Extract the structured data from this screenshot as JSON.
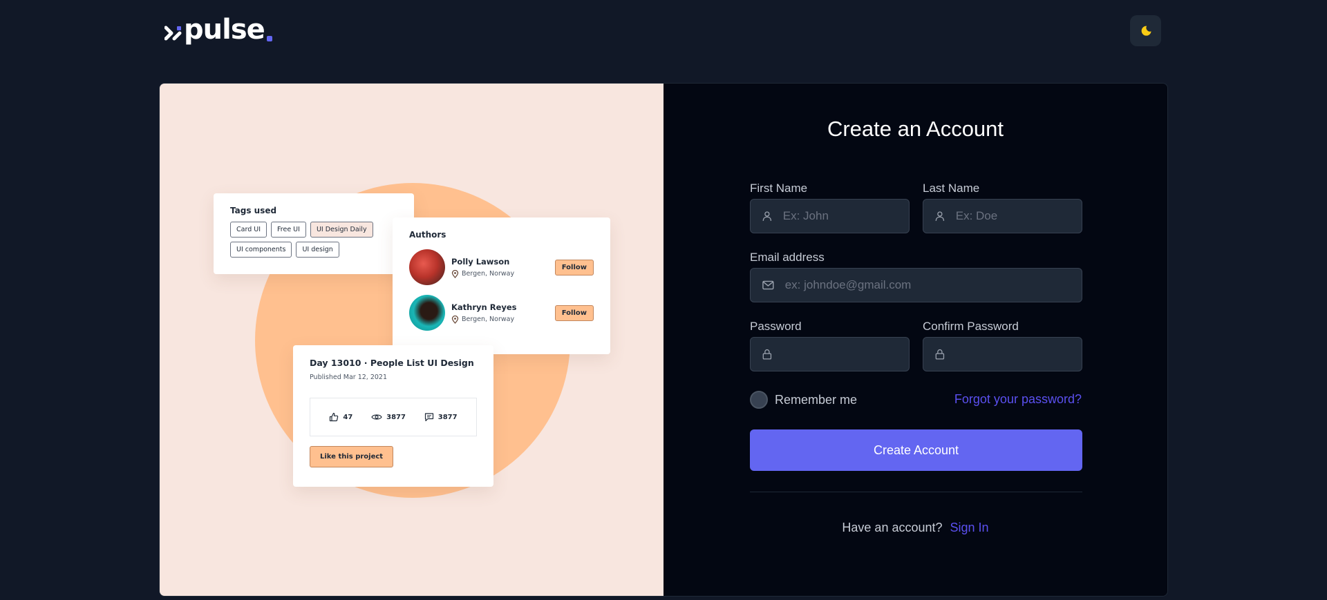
{
  "header": {
    "brand": "pulse",
    "theme_toggle_icon": "moon-icon",
    "colors": {
      "background": "#111827",
      "accent": "#6366f1",
      "moon": "#facc15"
    }
  },
  "illustration": {
    "tags_card": {
      "title": "Tags used",
      "tags": [
        "Card UI",
        "Free UI",
        "UI Design Daily",
        "UI components",
        "UI design"
      ]
    },
    "authors_card": {
      "title": "Authors",
      "authors": [
        {
          "name": "Polly Lawson",
          "location": "Bergen, Norway",
          "action": "Follow"
        },
        {
          "name": "Kathryn Reyes",
          "location": "Bergen, Norway",
          "action": "Follow"
        }
      ]
    },
    "project_card": {
      "title": "Day 13010 · People List UI Design",
      "published": "Published Mar 12, 2021",
      "likes": "47",
      "views": "3877",
      "comments": "3877",
      "cta": "Like this project"
    }
  },
  "form": {
    "title": "Create an Account",
    "first_name": {
      "label": "First Name",
      "placeholder": "Ex: John",
      "value": ""
    },
    "last_name": {
      "label": "Last Name",
      "placeholder": "Ex: Doe",
      "value": ""
    },
    "email": {
      "label": "Email address",
      "placeholder": "ex: johndoe@gmail.com",
      "value": ""
    },
    "password": {
      "label": "Password",
      "value": ""
    },
    "confirm_password": {
      "label": "Confirm Password",
      "value": ""
    },
    "remember_me": "Remember me",
    "forgot_password": "Forgot your password?",
    "submit": "Create Account",
    "have_account": "Have an account?",
    "sign_in": "Sign In"
  }
}
